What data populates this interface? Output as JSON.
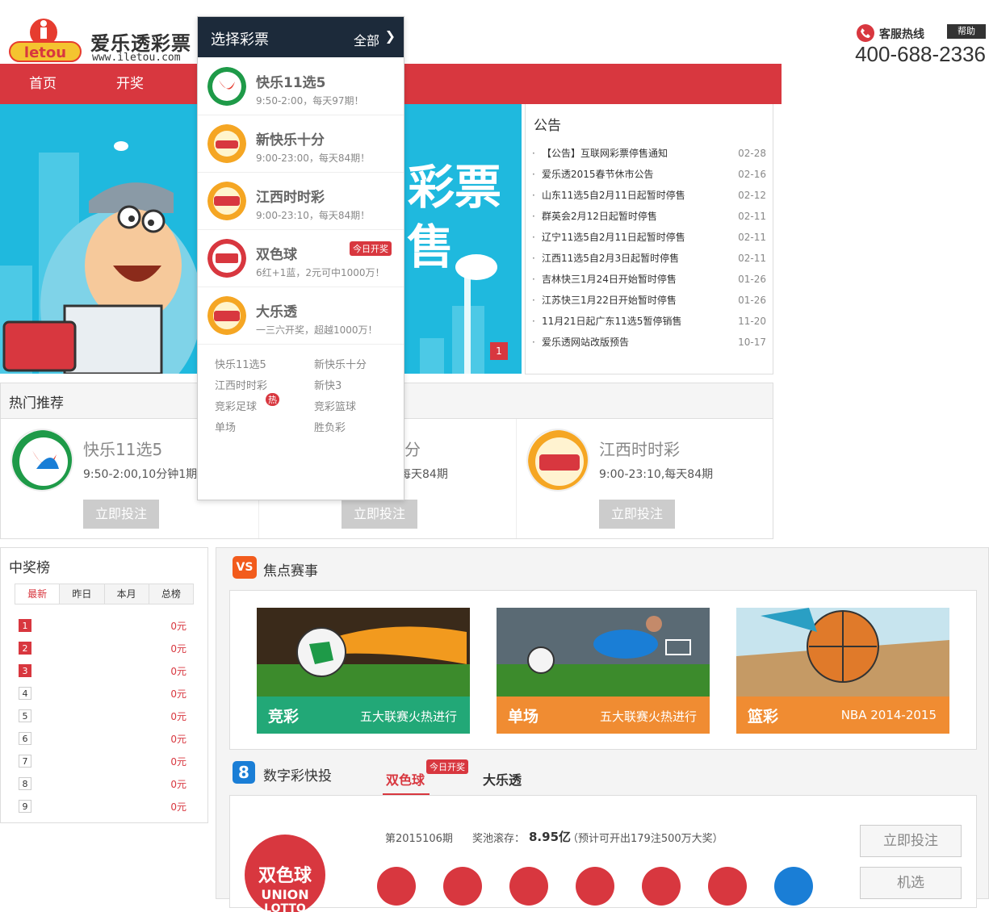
{
  "logo": {
    "brand": "爱乐透彩票",
    "url": "www.iletou.com",
    "mascot_text": "letou"
  },
  "hotline": {
    "label": "客服热线",
    "help": "帮助",
    "number": "400-688-2336"
  },
  "nav": {
    "items": [
      "首页",
      "开奖"
    ]
  },
  "banner": {
    "text1": "彩票",
    "text2": "售",
    "page": "1"
  },
  "dropdown": {
    "title": "选择彩票",
    "filter": "全部",
    "lotteries": [
      {
        "name": "快乐11选5",
        "desc": "9:50-2:00，每天97期！",
        "badge": ""
      },
      {
        "name": "新快乐十分",
        "desc": "9:00-23:00，每天84期！",
        "badge": ""
      },
      {
        "name": "江西时时彩",
        "desc": "9:00-23:10，每天84期！",
        "badge": ""
      },
      {
        "name": "双色球",
        "desc": "6红+1蓝，2元可中1000万！",
        "badge": "今日开奖"
      },
      {
        "name": "大乐透",
        "desc": "一三六开奖，超越1000万！",
        "badge": ""
      }
    ],
    "quick_links": [
      "快乐11选5",
      "新快乐十分",
      "江西时时彩",
      "新快3",
      "竞彩足球",
      "竞彩篮球",
      "单场",
      "胜负彩"
    ],
    "hot_badge": "热"
  },
  "notice": {
    "title": "公告",
    "items": [
      {
        "text": "【公告】互联网彩票停售通知",
        "date": "02-28"
      },
      {
        "text": "爱乐透2015春节休市公告",
        "date": "02-16"
      },
      {
        "text": "山东11选5自2月11日起暂时停售",
        "date": "02-12"
      },
      {
        "text": "群英会2月12日起暂时停售",
        "date": "02-11"
      },
      {
        "text": "辽宁11选5自2月11日起暂时停售",
        "date": "02-11"
      },
      {
        "text": "江西11选5自2月3日起暂时停售",
        "date": "02-11"
      },
      {
        "text": "吉林快三1月24日开始暂时停售",
        "date": "01-26"
      },
      {
        "text": "江苏快三1月22日开始暂时停售",
        "date": "01-26"
      },
      {
        "text": "11月21日起广东11选5暂停销售",
        "date": "11-20"
      },
      {
        "text": "爱乐透网站改版预告",
        "date": "10-17"
      }
    ]
  },
  "hot": {
    "title": "热门推荐",
    "cards": [
      {
        "name": "快乐11选5",
        "time": "9:50-2:00,10分钟1期",
        "button": "立即投注"
      },
      {
        "name": "一分",
        "time": "每天84期",
        "button": "立即投注"
      },
      {
        "name": "江西时时彩",
        "time": "9:00-23:10,每天84期",
        "button": "立即投注"
      }
    ]
  },
  "rank": {
    "title": "中奖榜",
    "tabs": [
      "最新",
      "昨日",
      "本月",
      "总榜"
    ],
    "rows": [
      {
        "n": "1",
        "v": "0元"
      },
      {
        "n": "2",
        "v": "0元"
      },
      {
        "n": "3",
        "v": "0元"
      },
      {
        "n": "4",
        "v": "0元"
      },
      {
        "n": "5",
        "v": "0元"
      },
      {
        "n": "6",
        "v": "0元"
      },
      {
        "n": "7",
        "v": "0元"
      },
      {
        "n": "8",
        "v": "0元"
      },
      {
        "n": "9",
        "v": "0元"
      }
    ]
  },
  "focus": {
    "vs": "VS",
    "title": "焦点赛事",
    "matches": [
      {
        "name": "竞彩",
        "sub": "五大联赛火热进行",
        "color": "#22a877"
      },
      {
        "name": "单场",
        "sub": "五大联赛火热进行",
        "color": "#22a877"
      },
      {
        "name": "篮彩",
        "sub": "NBA 2014-2015",
        "color": "#f08c32"
      }
    ]
  },
  "digit": {
    "icon": "8",
    "title": "数字彩快投",
    "tab_ssq": "双色球",
    "tab_badge": "今日开奖",
    "tab_dlt": "大乐透",
    "issue": "第2015106期",
    "pool_label": "奖池滚存：",
    "pool_value": "8.95亿",
    "pool_note": "（预计可开出179注500万大奖）",
    "btn_bet": "立即投注",
    "btn_random": "机选",
    "ssq_logo_top": "双色球",
    "ssq_logo_mid": "UNION",
    "ssq_logo_bot": "LOTTO"
  }
}
